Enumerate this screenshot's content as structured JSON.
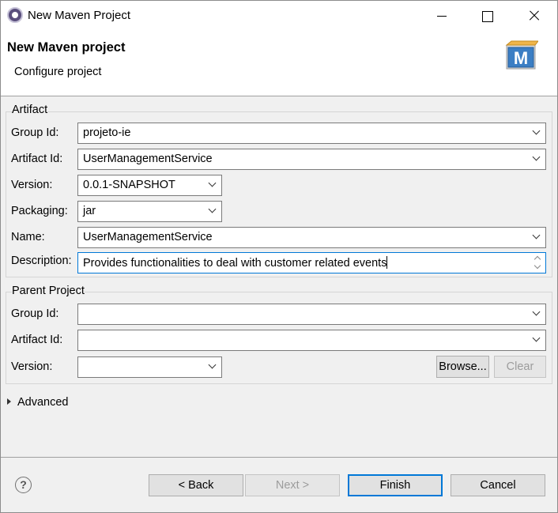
{
  "window": {
    "title": "New Maven Project"
  },
  "header": {
    "title": "New Maven project",
    "subtitle": "Configure project"
  },
  "artifact": {
    "legend": "Artifact",
    "group_id_label": "Group Id:",
    "group_id_value": "projeto-ie",
    "artifact_id_label": "Artifact Id:",
    "artifact_id_value": "UserManagementService",
    "version_label": "Version:",
    "version_value": "0.0.1-SNAPSHOT",
    "packaging_label": "Packaging:",
    "packaging_value": "jar",
    "name_label": "Name:",
    "name_value": "UserManagementService",
    "description_label": "Description:",
    "description_value": "Provides functionalities to deal with customer related events"
  },
  "parent": {
    "legend": "Parent Project",
    "group_id_label": "Group Id:",
    "group_id_value": "",
    "artifact_id_label": "Artifact Id:",
    "artifact_id_value": "",
    "version_label": "Version:",
    "version_value": "",
    "browse_label": "Browse...",
    "clear_label": "Clear"
  },
  "advanced": {
    "label": "Advanced"
  },
  "footer": {
    "help_glyph": "?",
    "back_label": "< Back",
    "next_label": "Next >",
    "finish_label": "Finish",
    "cancel_label": "Cancel"
  },
  "colors": {
    "focus_border": "#0078d7",
    "maven_icon_blue": "#2f72b8",
    "disabled_text": "#9c9c9c"
  }
}
